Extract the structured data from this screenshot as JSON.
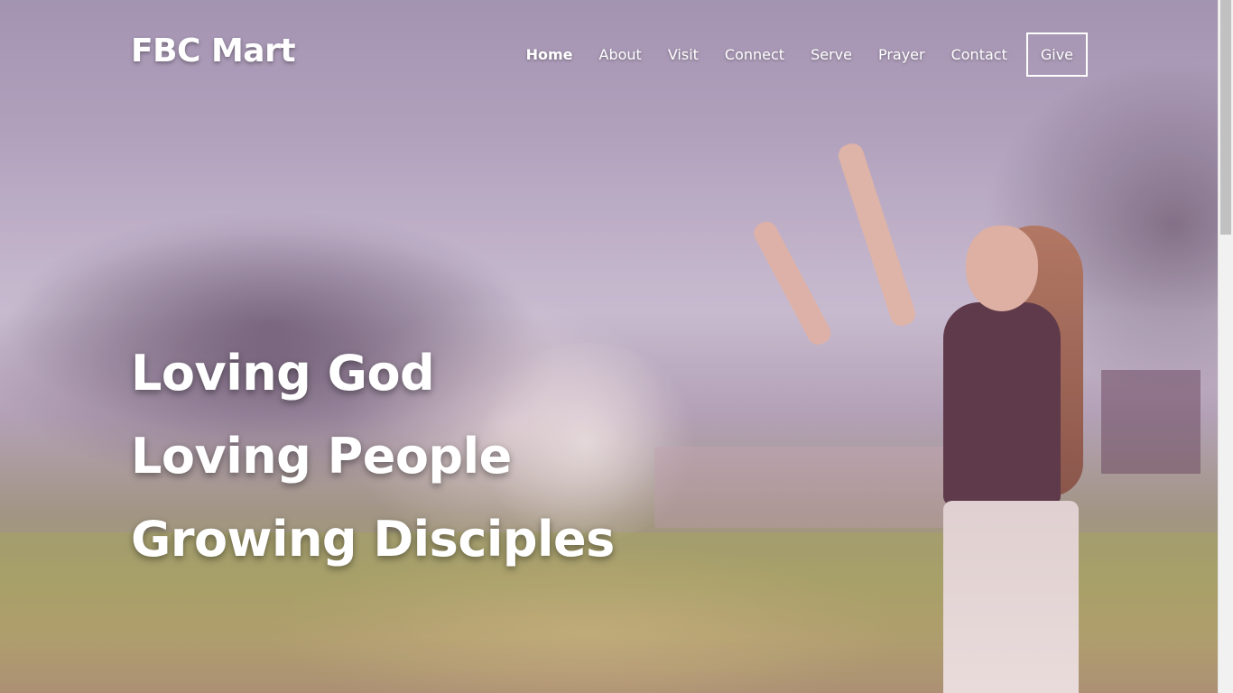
{
  "header": {
    "logo": "FBC Mart",
    "nav": [
      {
        "label": "Home",
        "active": true
      },
      {
        "label": "About",
        "active": false
      },
      {
        "label": "Visit",
        "active": false
      },
      {
        "label": "Connect",
        "active": false
      },
      {
        "label": "Serve",
        "active": false
      },
      {
        "label": "Prayer",
        "active": false
      },
      {
        "label": "Contact",
        "active": false
      },
      {
        "label": "Give",
        "active": false
      }
    ]
  },
  "hero": {
    "lines": [
      "Loving God",
      "Loving People",
      "Growing Disciples"
    ]
  },
  "colors": {
    "text": "#ffffff",
    "overlay_tint": "#b6a6c1"
  }
}
